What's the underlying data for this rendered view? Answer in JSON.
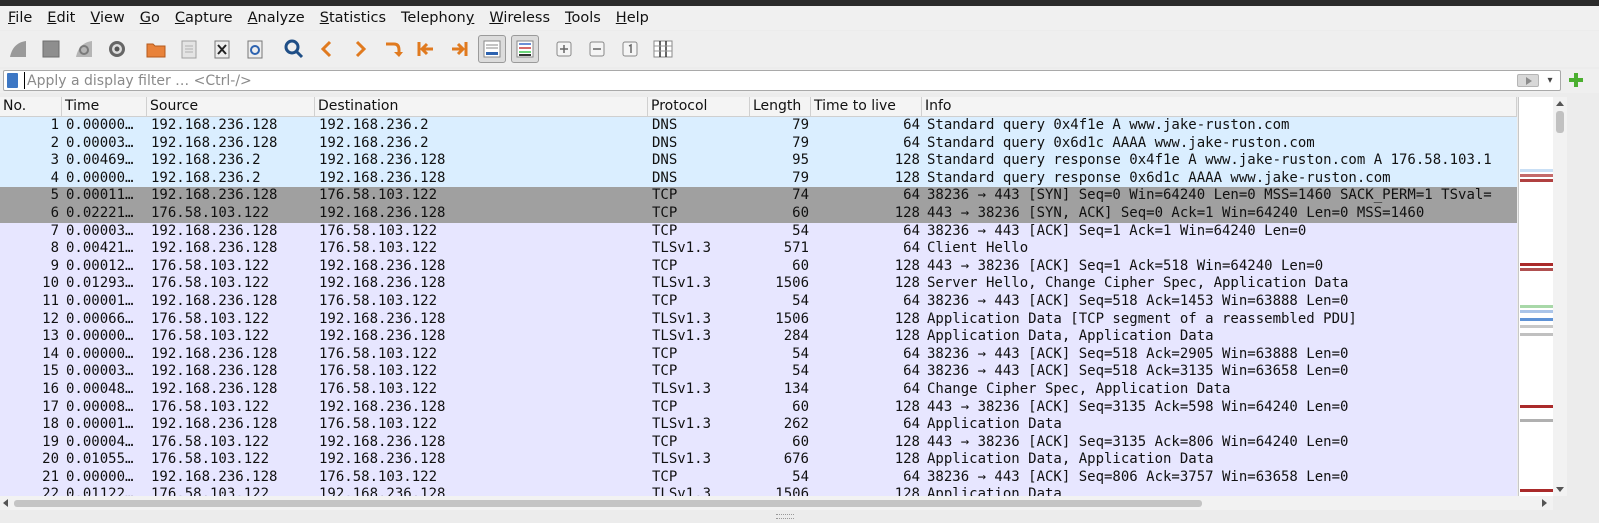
{
  "menu": [
    "File",
    "Edit",
    "View",
    "Go",
    "Capture",
    "Analyze",
    "Statistics",
    "Telephony",
    "Wireless",
    "Tools",
    "Help"
  ],
  "menu_accel": [
    "F",
    "E",
    "V",
    "G",
    "C",
    "A",
    "S",
    "y",
    "W",
    "T",
    "H"
  ],
  "toolbar": [
    "start-capture-icon",
    "stop-capture-icon",
    "restart-capture-icon",
    "capture-options-icon",
    "open-file-icon",
    "save-file-icon",
    "close-file-icon",
    "reload-file-icon",
    "find-packet-icon",
    "go-back-icon",
    "go-forward-icon",
    "go-to-packet-icon",
    "first-packet-icon",
    "last-packet-icon",
    "auto-scroll-icon",
    "colorize-icon",
    "zoom-in-icon",
    "zoom-out-icon",
    "normal-size-icon",
    "resize-columns-icon"
  ],
  "filter": {
    "placeholder": "Apply a display filter … <Ctrl-/>",
    "value": ""
  },
  "columns": [
    "No.",
    "Time",
    "Source",
    "Destination",
    "Protocol",
    "Length",
    "Time to live",
    "Info"
  ],
  "packets": [
    {
      "no": "1",
      "time": "0.00000…",
      "src": "192.168.236.128",
      "dst": "192.168.236.2",
      "proto": "DNS",
      "len": "79",
      "ttl": "64",
      "info": "Standard query 0x4f1e A www.jake-ruston.com",
      "kind": "dns"
    },
    {
      "no": "2",
      "time": "0.00003…",
      "src": "192.168.236.128",
      "dst": "192.168.236.2",
      "proto": "DNS",
      "len": "79",
      "ttl": "64",
      "info": "Standard query 0x6d1c AAAA www.jake-ruston.com",
      "kind": "dns"
    },
    {
      "no": "3",
      "time": "0.00469…",
      "src": "192.168.236.2",
      "dst": "192.168.236.128",
      "proto": "DNS",
      "len": "95",
      "ttl": "128",
      "info": "Standard query response 0x4f1e A www.jake-ruston.com A 176.58.103.1",
      "kind": "dns"
    },
    {
      "no": "4",
      "time": "0.00000…",
      "src": "192.168.236.2",
      "dst": "192.168.236.128",
      "proto": "DNS",
      "len": "79",
      "ttl": "128",
      "info": "Standard query response 0x6d1c AAAA www.jake-ruston.com",
      "kind": "dns"
    },
    {
      "no": "5",
      "time": "0.00011…",
      "src": "192.168.236.128",
      "dst": "176.58.103.122",
      "proto": "TCP",
      "len": "74",
      "ttl": "64",
      "info": "38236 → 443 [SYN] Seq=0 Win=64240 Len=0 MSS=1460 SACK_PERM=1 TSval=",
      "kind": "syn"
    },
    {
      "no": "6",
      "time": "0.02221…",
      "src": "176.58.103.122",
      "dst": "192.168.236.128",
      "proto": "TCP",
      "len": "60",
      "ttl": "128",
      "info": "443 → 38236 [SYN, ACK] Seq=0 Ack=1 Win=64240 Len=0 MSS=1460",
      "kind": "syn"
    },
    {
      "no": "7",
      "time": "0.00003…",
      "src": "192.168.236.128",
      "dst": "176.58.103.122",
      "proto": "TCP",
      "len": "54",
      "ttl": "64",
      "info": "38236 → 443 [ACK] Seq=1 Ack=1 Win=64240 Len=0",
      "kind": "tcp"
    },
    {
      "no": "8",
      "time": "0.00421…",
      "src": "192.168.236.128",
      "dst": "176.58.103.122",
      "proto": "TLSv1.3",
      "len": "571",
      "ttl": "64",
      "info": "Client Hello",
      "kind": "tls"
    },
    {
      "no": "9",
      "time": "0.00012…",
      "src": "176.58.103.122",
      "dst": "192.168.236.128",
      "proto": "TCP",
      "len": "60",
      "ttl": "128",
      "info": "443 → 38236 [ACK] Seq=1 Ack=518 Win=64240 Len=0",
      "kind": "tcp"
    },
    {
      "no": "10",
      "time": "0.01293…",
      "src": "176.58.103.122",
      "dst": "192.168.236.128",
      "proto": "TLSv1.3",
      "len": "1506",
      "ttl": "128",
      "info": "Server Hello, Change Cipher Spec, Application Data",
      "kind": "tls"
    },
    {
      "no": "11",
      "time": "0.00001…",
      "src": "192.168.236.128",
      "dst": "176.58.103.122",
      "proto": "TCP",
      "len": "54",
      "ttl": "64",
      "info": "38236 → 443 [ACK] Seq=518 Ack=1453 Win=63888 Len=0",
      "kind": "tcp"
    },
    {
      "no": "12",
      "time": "0.00066…",
      "src": "176.58.103.122",
      "dst": "192.168.236.128",
      "proto": "TLSv1.3",
      "len": "1506",
      "ttl": "128",
      "info": "Application Data [TCP segment of a reassembled PDU]",
      "kind": "tls"
    },
    {
      "no": "13",
      "time": "0.00000…",
      "src": "176.58.103.122",
      "dst": "192.168.236.128",
      "proto": "TLSv1.3",
      "len": "284",
      "ttl": "128",
      "info": "Application Data, Application Data",
      "kind": "tls"
    },
    {
      "no": "14",
      "time": "0.00000…",
      "src": "192.168.236.128",
      "dst": "176.58.103.122",
      "proto": "TCP",
      "len": "54",
      "ttl": "64",
      "info": "38236 → 443 [ACK] Seq=518 Ack=2905 Win=63888 Len=0",
      "kind": "tcp"
    },
    {
      "no": "15",
      "time": "0.00003…",
      "src": "192.168.236.128",
      "dst": "176.58.103.122",
      "proto": "TCP",
      "len": "54",
      "ttl": "64",
      "info": "38236 → 443 [ACK] Seq=518 Ack=3135 Win=63658 Len=0",
      "kind": "tcp"
    },
    {
      "no": "16",
      "time": "0.00048…",
      "src": "192.168.236.128",
      "dst": "176.58.103.122",
      "proto": "TLSv1.3",
      "len": "134",
      "ttl": "64",
      "info": "Change Cipher Spec, Application Data",
      "kind": "tls"
    },
    {
      "no": "17",
      "time": "0.00008…",
      "src": "176.58.103.122",
      "dst": "192.168.236.128",
      "proto": "TCP",
      "len": "60",
      "ttl": "128",
      "info": "443 → 38236 [ACK] Seq=3135 Ack=598 Win=64240 Len=0",
      "kind": "tcp"
    },
    {
      "no": "18",
      "time": "0.00001…",
      "src": "192.168.236.128",
      "dst": "176.58.103.122",
      "proto": "TLSv1.3",
      "len": "262",
      "ttl": "64",
      "info": "Application Data",
      "kind": "tls"
    },
    {
      "no": "19",
      "time": "0.00004…",
      "src": "176.58.103.122",
      "dst": "192.168.236.128",
      "proto": "TCP",
      "len": "60",
      "ttl": "128",
      "info": "443 → 38236 [ACK] Seq=3135 Ack=806 Win=64240 Len=0",
      "kind": "tcp"
    },
    {
      "no": "20",
      "time": "0.01055…",
      "src": "176.58.103.122",
      "dst": "192.168.236.128",
      "proto": "TLSv1.3",
      "len": "676",
      "ttl": "128",
      "info": "Application Data, Application Data",
      "kind": "tls"
    },
    {
      "no": "21",
      "time": "0.00000…",
      "src": "192.168.236.128",
      "dst": "176.58.103.122",
      "proto": "TCP",
      "len": "54",
      "ttl": "64",
      "info": "38236 → 443 [ACK] Seq=806 Ack=3757 Win=63658 Len=0",
      "kind": "tcp"
    },
    {
      "no": "22",
      "time": "0.01122…",
      "src": "176.58.103.122",
      "dst": "192.168.236.128",
      "proto": "TLSv1.3",
      "len": "1506",
      "ttl": "128",
      "info": "Application Data",
      "kind": "tls"
    }
  ],
  "colors": {
    "dns": "#daeeff",
    "tcp": "#e7e6ff",
    "syn": "#a0a0a0",
    "accent": "#3d77c4"
  }
}
